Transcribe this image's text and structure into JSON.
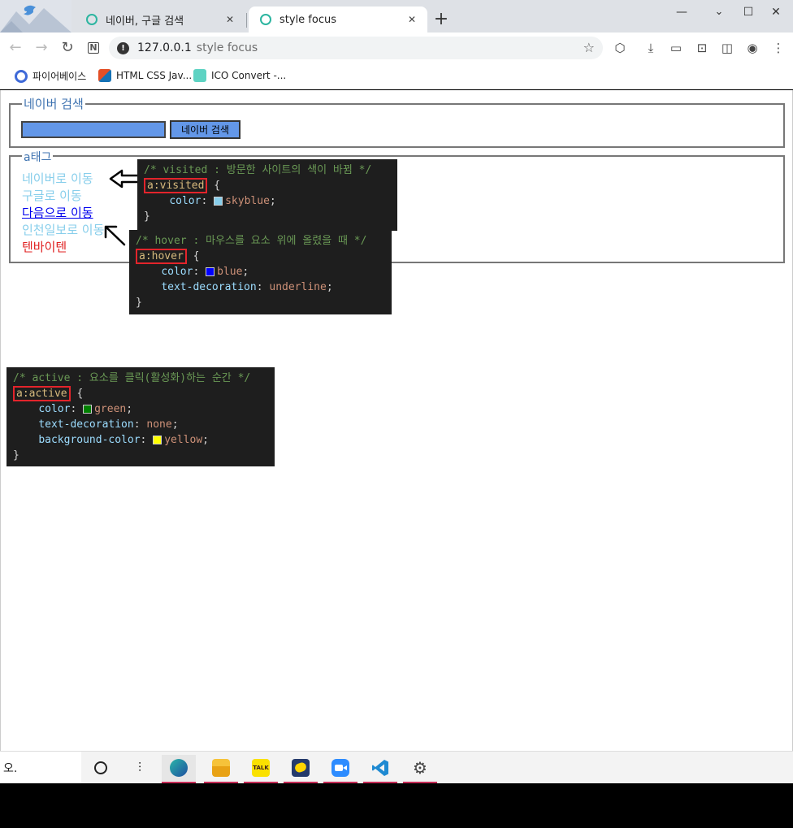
{
  "browser": {
    "tabs": [
      {
        "title": "네이버, 구글 검색"
      },
      {
        "title": "style focus"
      }
    ],
    "new_tab": "+",
    "window_controls": {
      "minimize": "—",
      "maximize": "☐",
      "close": "✕"
    },
    "address": {
      "host": "127.0.0.1",
      "path": "style focus"
    },
    "bookmarks": [
      {
        "label": "파이어베이스",
        "icon": "firebase-icon"
      },
      {
        "label": "HTML CSS Jav...",
        "icon": "html-css-icon"
      },
      {
        "label": "ICO Convert -...",
        "icon": "ico-convert-icon"
      }
    ]
  },
  "page": {
    "search_fieldset": {
      "legend": "네이버 검색",
      "button": "네이버 검색",
      "input_value": ""
    },
    "link_fieldset": {
      "legend": "a태그",
      "links": [
        {
          "text": "네이버로 이동",
          "color": "#87ceeb"
        },
        {
          "text": "구글로 이동",
          "color": "#87ceeb"
        },
        {
          "text": "다음으로 이동",
          "color": "#0000ee"
        },
        {
          "text": "인천일보로 이동",
          "color": "#87ceeb"
        },
        {
          "text": "텐바이텐",
          "color": "#e02020"
        }
      ]
    },
    "snippets": {
      "visited": {
        "comment": "/* visited : 방문한 사이트의 색이 바뀜 */",
        "selector": "a:visited",
        "open": " {",
        "prop1": "color",
        "val1": "skyblue",
        "close": "}"
      },
      "hover": {
        "comment": "/* hover : 마우스를 요소 위에 올렸을 때 */",
        "selector": "a:hover",
        "open": " {",
        "prop1": "color",
        "val1": "blue",
        "prop2": "text-decoration",
        "val2": "underline",
        "close": "}"
      },
      "active": {
        "comment": "/* active : 요소를 클릭(활성화)하는 순간 */",
        "selector": "a:active",
        "open": " {",
        "prop1": "color",
        "val1": "green",
        "prop2": "text-decoration",
        "val2": "none",
        "prop3": "background-color",
        "val3": "yellow",
        "close": "}"
      }
    }
  },
  "taskbar": {
    "search_text": "오."
  }
}
